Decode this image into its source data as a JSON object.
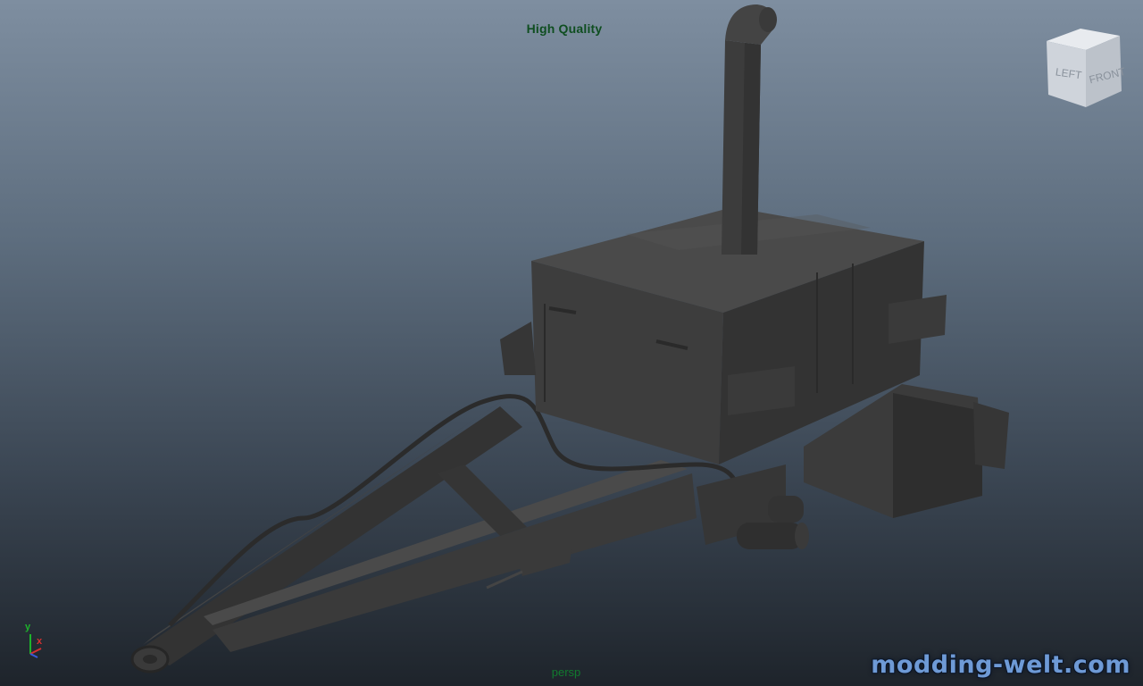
{
  "viewport": {
    "display_mode": "High Quality",
    "camera": "persp",
    "background": {
      "top": "#7e8ea0",
      "bottom": "#1e242b"
    }
  },
  "viewcube": {
    "left_face": "LEFT",
    "front_face": "FRONT"
  },
  "axis": {
    "y_label": "y",
    "x_label": "x",
    "y_color": "#1db42b",
    "x_color": "#d63030",
    "z_color": "#3a5bd8"
  },
  "watermark": {
    "text": "modding-welt.com"
  },
  "model": {
    "fill": "#3e3e3e",
    "shade_dark": "#2f2f2f",
    "shade_light": "#494949"
  }
}
